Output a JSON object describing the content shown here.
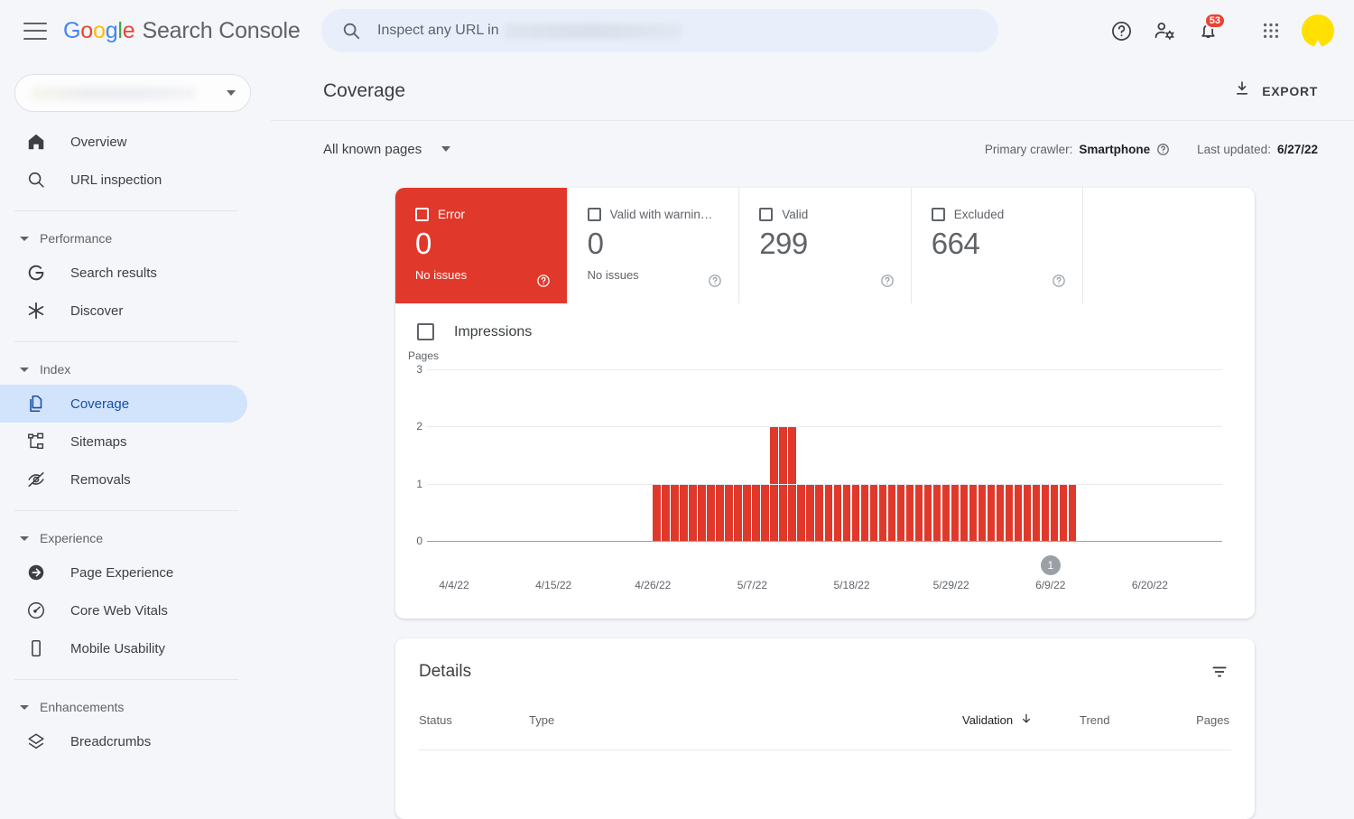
{
  "topbar": {
    "menu_icon": "hamburger-icon",
    "brand_google": "Google",
    "brand_product": "Search Console",
    "search_placeholder": "Inspect any URL in",
    "help_icon": "help-icon",
    "account_settings_icon": "account-settings-icon",
    "notifications_icon": "notifications-bell-icon",
    "notifications_count": "53",
    "apps_icon": "apps-grid-icon",
    "avatar_icon": "user-avatar"
  },
  "sidebar": {
    "property_selector_label": "",
    "items": [
      {
        "label": "Overview",
        "icon": "home-icon",
        "type": "item",
        "active": false
      },
      {
        "label": "URL inspection",
        "icon": "search-icon",
        "type": "item",
        "active": false
      },
      {
        "label": "Performance",
        "icon": "chevron-down-icon",
        "type": "group"
      },
      {
        "label": "Search results",
        "icon": "google-g-icon",
        "type": "item",
        "active": false
      },
      {
        "label": "Discover",
        "icon": "discover-asterisk-icon",
        "type": "item",
        "active": false
      },
      {
        "label": "Index",
        "icon": "chevron-down-icon",
        "type": "group"
      },
      {
        "label": "Coverage",
        "icon": "pages-copy-icon",
        "type": "item",
        "active": true
      },
      {
        "label": "Sitemaps",
        "icon": "sitemap-icon",
        "type": "item",
        "active": false
      },
      {
        "label": "Removals",
        "icon": "eye-off-icon",
        "type": "item",
        "active": false
      },
      {
        "label": "Experience",
        "icon": "chevron-down-icon",
        "type": "group"
      },
      {
        "label": "Page Experience",
        "icon": "page-experience-icon",
        "type": "item",
        "active": false
      },
      {
        "label": "Core Web Vitals",
        "icon": "speedometer-icon",
        "type": "item",
        "active": false
      },
      {
        "label": "Mobile Usability",
        "icon": "mobile-phone-icon",
        "type": "item",
        "active": false
      },
      {
        "label": "Enhancements",
        "icon": "chevron-down-icon",
        "type": "group"
      },
      {
        "label": "Breadcrumbs",
        "icon": "layers-icon",
        "type": "item",
        "active": false
      }
    ]
  },
  "page": {
    "title": "Coverage",
    "export_label": "EXPORT",
    "export_icon": "download-icon",
    "filter_label": "All known pages",
    "filter_icon": "chevron-down-icon",
    "primary_crawler_label": "Primary crawler:",
    "primary_crawler_value": "Smartphone",
    "crawler_help_icon": "help-circle-icon",
    "last_updated_label": "Last updated:",
    "last_updated_value": "6/27/22"
  },
  "status_cards": [
    {
      "name": "Error",
      "value": "0",
      "sub": "No issues",
      "checked": true,
      "highlight": true,
      "help_icon": "help-circle-icon"
    },
    {
      "name": "Valid with warnin…",
      "value": "0",
      "sub": "No issues",
      "checked": false,
      "highlight": false,
      "help_icon": "help-circle-icon"
    },
    {
      "name": "Valid",
      "value": "299",
      "sub": "",
      "checked": false,
      "highlight": false,
      "help_icon": "help-circle-icon"
    },
    {
      "name": "Excluded",
      "value": "664",
      "sub": "",
      "checked": false,
      "highlight": false,
      "help_icon": "help-circle-icon"
    }
  ],
  "chart_panel": {
    "impressions_label": "Impressions",
    "impressions_checked": false,
    "annotation_marker": "1"
  },
  "chart_data": {
    "type": "bar",
    "title": "",
    "ylabel": "Pages",
    "xlabel": "",
    "ylim": [
      0,
      3
    ],
    "yticks": [
      0,
      1,
      2,
      3
    ],
    "grid": true,
    "legend": "none",
    "series_color": "#E0392B",
    "xtick_labels": [
      "4/4/22",
      "4/15/22",
      "4/26/22",
      "5/7/22",
      "5/18/22",
      "5/29/22",
      "6/9/22",
      "6/20/22"
    ],
    "x_start_date": "4/1/22",
    "x_end_date": "6/27/22",
    "n_slots": 88,
    "first_bar_index": 25,
    "last_bar_index": 71,
    "values": [
      0,
      0,
      0,
      0,
      0,
      0,
      0,
      0,
      0,
      0,
      0,
      0,
      0,
      0,
      0,
      0,
      0,
      0,
      0,
      0,
      0,
      0,
      0,
      0,
      0,
      1,
      1,
      1,
      1,
      1,
      1,
      1,
      1,
      1,
      1,
      1,
      1,
      1,
      2,
      2,
      2,
      1,
      1,
      1,
      1,
      1,
      1,
      1,
      1,
      1,
      1,
      1,
      1,
      1,
      1,
      1,
      1,
      1,
      1,
      1,
      1,
      1,
      1,
      1,
      1,
      1,
      1,
      1,
      1,
      1,
      1,
      1,
      0,
      0,
      0,
      0,
      0,
      0,
      0,
      0,
      0,
      0,
      0,
      0,
      0,
      0,
      0,
      0
    ]
  },
  "details": {
    "title": "Details",
    "filter_icon": "filter-list-icon",
    "columns": [
      "Status",
      "Type",
      "Validation",
      "Trend",
      "Pages"
    ],
    "sort_column": "Validation",
    "sort_icon": "arrow-down-icon",
    "rows": []
  },
  "colors": {
    "error_red": "#E0392B",
    "badge_red": "#EA4335",
    "active_nav_blue": "#D2E3FC",
    "search_blue": "#E8EFFB",
    "page_bg": "#F5F6FA",
    "avatar_yellow": "#FFE000"
  }
}
